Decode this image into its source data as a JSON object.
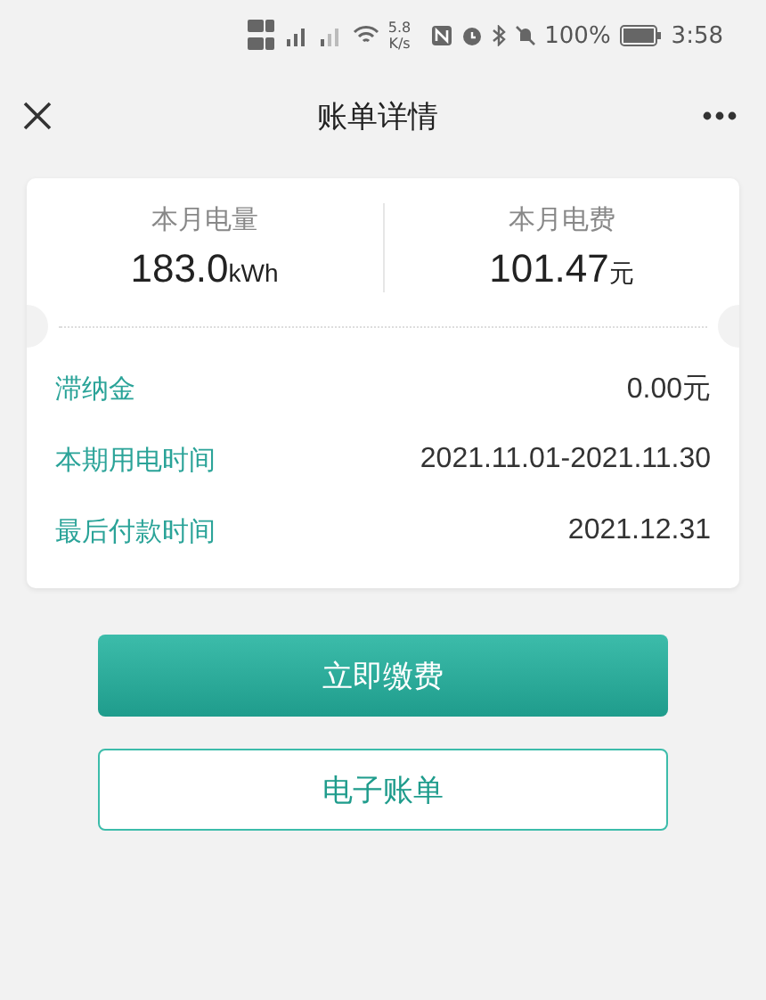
{
  "status_bar": {
    "net_speed": "5.8",
    "net_speed_unit": "K/s",
    "battery": "100%",
    "time": "3:58"
  },
  "nav": {
    "title": "账单详情"
  },
  "summary": [
    {
      "label": "本月电量",
      "value": "183.0",
      "unit": "kWh"
    },
    {
      "label": "本月电费",
      "value": "101.47",
      "unit": "元"
    }
  ],
  "details": [
    {
      "label": "滞纳金",
      "value": "0.00元"
    },
    {
      "label": "本期用电时间",
      "value": "2021.11.01-2021.11.30"
    },
    {
      "label": "最后付款时间",
      "value": "2021.12.31"
    }
  ],
  "buttons": [
    {
      "label": "立即缴费",
      "kind": "primary"
    },
    {
      "label": "电子账单",
      "kind": "outline"
    }
  ]
}
